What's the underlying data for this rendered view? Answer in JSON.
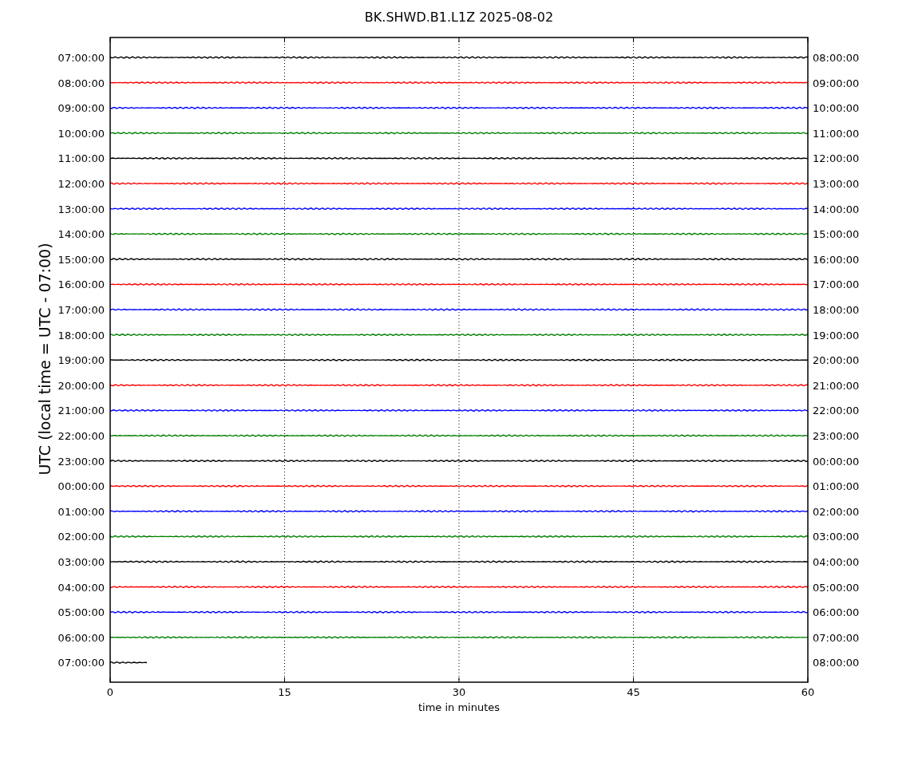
{
  "plot": {
    "title": "BK.SHWD.B1.L1Z 2025-08-02",
    "xlabel": "time in minutes",
    "ylabel": "UTC (local time = UTC - 07:00)",
    "xticks": [
      "0",
      "15",
      "30",
      "45",
      "60"
    ],
    "rows": [
      {
        "left_label": "07:00:00",
        "right_label": "08:00:00",
        "color": "#000000",
        "level": 1
      },
      {
        "left_label": "08:00:00",
        "right_label": "09:00:00",
        "color": "#ff0000",
        "level": 1
      },
      {
        "left_label": "09:00:00",
        "right_label": "10:00:00",
        "color": "#0000ff",
        "level": 1
      },
      {
        "left_label": "10:00:00",
        "right_label": "11:00:00",
        "color": "#008000",
        "level": 1
      },
      {
        "left_label": "11:00:00",
        "right_label": "12:00:00",
        "color": "#000000",
        "level": 1
      },
      {
        "left_label": "12:00:00",
        "right_label": "13:00:00",
        "color": "#ff0000",
        "level": 1
      },
      {
        "left_label": "13:00:00",
        "right_label": "14:00:00",
        "color": "#0000ff",
        "level": 1
      },
      {
        "left_label": "14:00:00",
        "right_label": "15:00:00",
        "color": "#008000",
        "level": 1
      },
      {
        "left_label": "15:00:00",
        "right_label": "16:00:00",
        "color": "#000000",
        "level": 1
      },
      {
        "left_label": "16:00:00",
        "right_label": "17:00:00",
        "color": "#ff0000",
        "level": 1
      },
      {
        "left_label": "17:00:00",
        "right_label": "18:00:00",
        "color": "#0000ff",
        "level": 1
      },
      {
        "left_label": "18:00:00",
        "right_label": "19:00:00",
        "color": "#008000",
        "level": 1
      },
      {
        "left_label": "19:00:00",
        "right_label": "20:00:00",
        "color": "#000000",
        "level": 1
      },
      {
        "left_label": "20:00:00",
        "right_label": "21:00:00",
        "color": "#ff0000",
        "level": 1
      },
      {
        "left_label": "21:00:00",
        "right_label": "22:00:00",
        "color": "#0000ff",
        "level": 1
      },
      {
        "left_label": "22:00:00",
        "right_label": "23:00:00",
        "color": "#008000",
        "level": 1
      },
      {
        "left_label": "23:00:00",
        "right_label": "00:00:00",
        "color": "#000000",
        "level": 1
      },
      {
        "left_label": "00:00:00",
        "right_label": "01:00:00",
        "color": "#ff0000",
        "level": 1
      },
      {
        "left_label": "01:00:00",
        "right_label": "02:00:00",
        "color": "#0000ff",
        "level": 1
      },
      {
        "left_label": "02:00:00",
        "right_label": "03:00:00",
        "color": "#008000",
        "level": 1
      },
      {
        "left_label": "03:00:00",
        "right_label": "04:00:00",
        "color": "#000000",
        "level": 1
      },
      {
        "left_label": "04:00:00",
        "right_label": "05:00:00",
        "color": "#ff0000",
        "level": 1
      },
      {
        "left_label": "05:00:00",
        "right_label": "06:00:00",
        "color": "#0000ff",
        "level": 1
      },
      {
        "left_label": "06:00:00",
        "right_label": "07:00:00",
        "color": "#008000",
        "level": 1
      },
      {
        "left_label": "07:00:00",
        "right_label": "08:00:00",
        "color": "#000000",
        "level": 0.053
      }
    ]
  }
}
